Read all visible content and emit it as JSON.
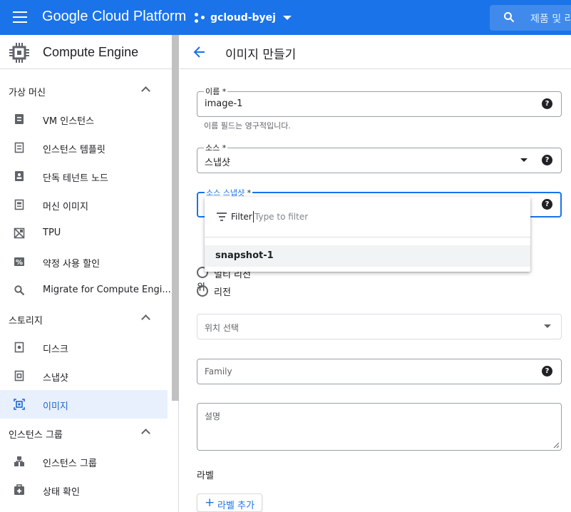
{
  "header": {
    "brand": "Google Cloud Platform",
    "project": "gcloud-byej",
    "search_placeholder": "제품 및 리"
  },
  "sidebar": {
    "product": "Compute Engine",
    "sections": [
      {
        "label": "가상 머신",
        "items": [
          {
            "label": "VM 인스턴스",
            "icon": "vm-instance-icon"
          },
          {
            "label": "인스턴스 템플릿",
            "icon": "instance-template-icon"
          },
          {
            "label": "단독 테넌트 노드",
            "icon": "sole-tenant-node-icon"
          },
          {
            "label": "머신 이미지",
            "icon": "machine-image-icon"
          },
          {
            "label": "TPU",
            "icon": "tpu-icon"
          },
          {
            "label": "약정 사용 할인",
            "icon": "percent-icon"
          },
          {
            "label": "Migrate for Compute Engi...",
            "icon": "search-icon"
          }
        ]
      },
      {
        "label": "스토리지",
        "items": [
          {
            "label": "디스크",
            "icon": "disk-icon"
          },
          {
            "label": "스냅샷",
            "icon": "snapshot-icon"
          },
          {
            "label": "이미지",
            "icon": "image-icon",
            "active": true
          }
        ]
      },
      {
        "label": "인스턴스 그룹",
        "items": [
          {
            "label": "인스턴스 그룹",
            "icon": "instance-group-icon"
          },
          {
            "label": "상태 확인",
            "icon": "health-check-icon"
          }
        ]
      }
    ]
  },
  "page": {
    "title": "이미지 만들기",
    "name_field": {
      "label": "이름",
      "required": "*",
      "value": "image-1",
      "hint": "이름 필드는 영구적입니다."
    },
    "source_field": {
      "label": "소스",
      "required": "*",
      "value": "스냅샷"
    },
    "snapshot_field": {
      "label": "소스 스냅샷",
      "required": "*"
    },
    "location": {
      "label_fragment": "위",
      "options": [
        "멀티 리전",
        "리전"
      ]
    },
    "location_select": {
      "placeholder": "위치 선택"
    },
    "family_field": {
      "placeholder": "Family"
    },
    "description_field": {
      "placeholder": "설명"
    },
    "labels": {
      "title": "라벨",
      "add_button": "라벨 추가"
    }
  },
  "dropdown": {
    "filter_label": "Filter",
    "filter_placeholder": "Type to filter",
    "options": [
      "snapshot-1"
    ]
  },
  "colors": {
    "accent": "#1a73e8",
    "active_bg": "#e8f0fe",
    "active_text": "#1967d2"
  }
}
